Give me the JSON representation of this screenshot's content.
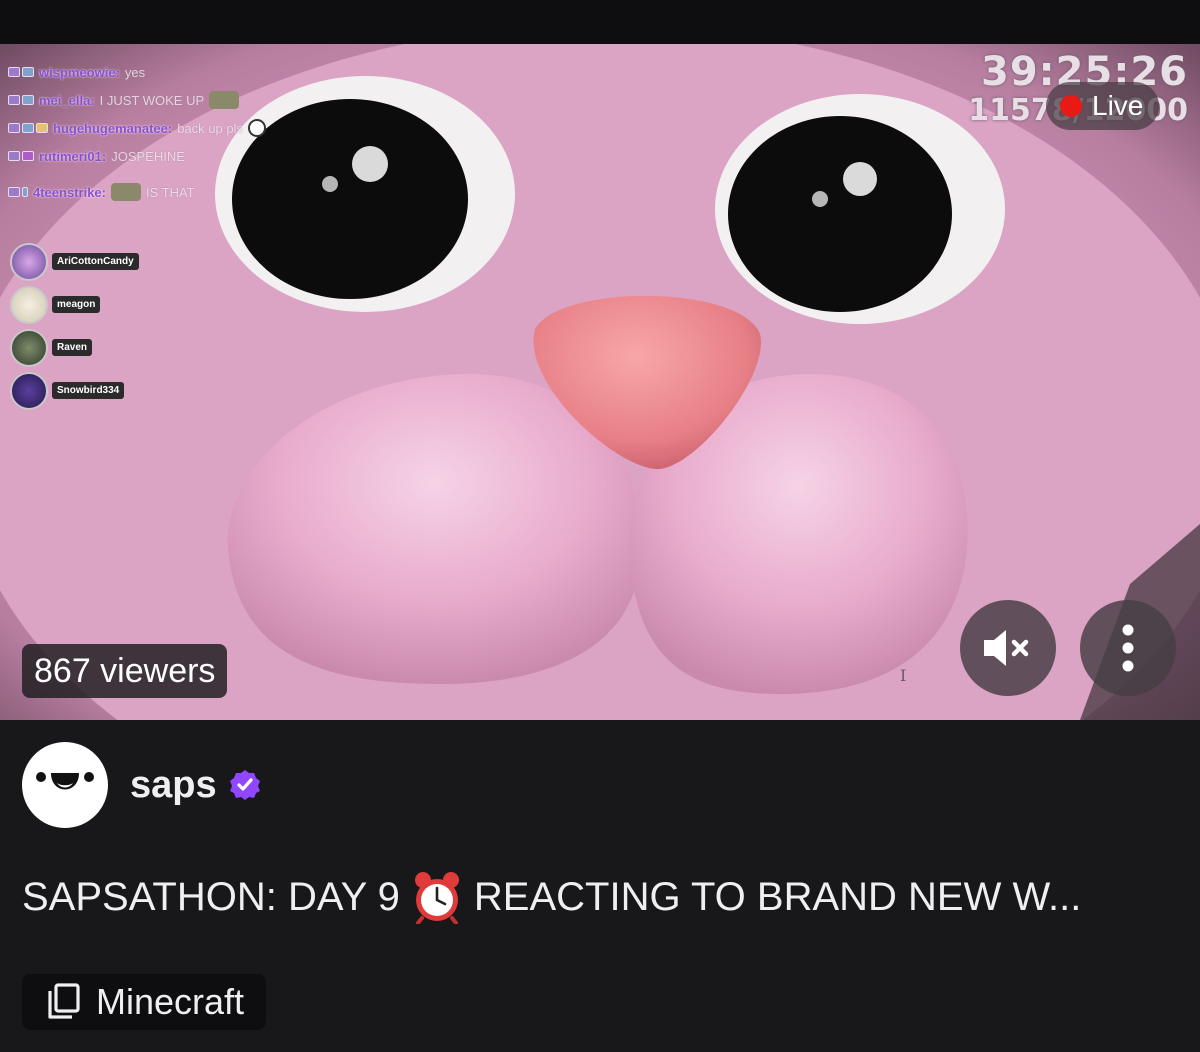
{
  "chat": {
    "messages": [
      {
        "user": "wispmeowie:",
        "text": "yes",
        "emote": ""
      },
      {
        "user": "mei_ella:",
        "text": "I JUST WOKE UP",
        "emote": "emote"
      },
      {
        "user": "hugehugemanatee:",
        "text": "back up pls",
        "emote": "smile"
      },
      {
        "user": "rutimeri01:",
        "text": "JOSPEHINE",
        "emote": ""
      },
      {
        "user": "4teenstrike:",
        "text": "IS THAT",
        "emote": "emote"
      }
    ],
    "voice_participants": [
      "AriCottonCandy",
      "meagon",
      "Raven",
      "Snowbird334"
    ]
  },
  "overlay": {
    "timer": "39:25:26",
    "sub_goal": "11578/12000"
  },
  "player": {
    "live_label": "Live",
    "viewers": "867 viewers",
    "mute_icon": "mute-icon",
    "more_icon": "more-vertical-icon",
    "cursor_glyph": "I"
  },
  "channel": {
    "name": "saps",
    "verified": true,
    "verified_color": "#9146ff"
  },
  "stream": {
    "title_before": "SAPSATHON: DAY 9",
    "title_emoji": "alarm-clock-icon",
    "title_after": "REACTING TO BRAND NEW W...",
    "category": "Minecraft",
    "category_icon": "copy-icon"
  },
  "colors": {
    "live": "#e91916",
    "background": "#18181b",
    "chat_username": "#8a4fd6"
  }
}
